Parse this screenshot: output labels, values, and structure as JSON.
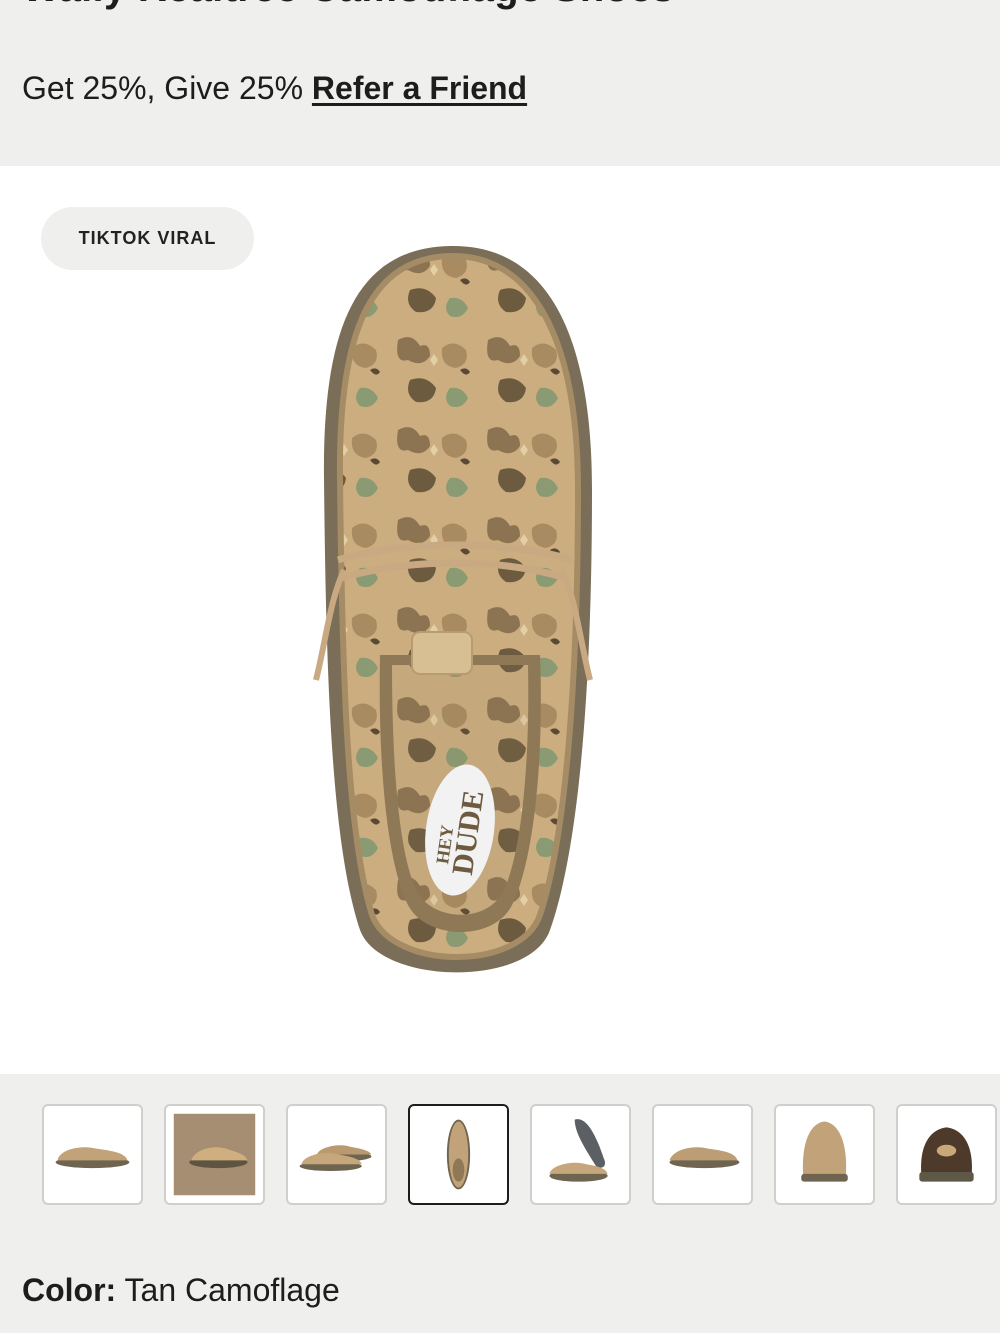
{
  "product": {
    "title": "Wally Realtree Camouflage Shoes"
  },
  "promo": {
    "text": "Get 25%, Give 25%",
    "link_label": "Refer a Friend"
  },
  "hero": {
    "badge": "TIKTOK VIRAL",
    "insole_logo_line1": "HEY",
    "insole_logo_line2": "DUDE"
  },
  "thumbnails": [
    {
      "view": "side",
      "active": false
    },
    {
      "view": "lifestyle",
      "active": false
    },
    {
      "view": "pair-side",
      "active": false
    },
    {
      "view": "top",
      "active": true
    },
    {
      "view": "sole",
      "active": false
    },
    {
      "view": "side-alt",
      "active": false
    },
    {
      "view": "front",
      "active": false
    },
    {
      "view": "back",
      "active": false
    }
  ],
  "color": {
    "label": "Color:",
    "value": "Tan Camoflage"
  },
  "colors": {
    "background": "#efefed",
    "camo_base": "#c9a97a",
    "camo_dark": "#7a6547",
    "sole": "#6e6450"
  }
}
